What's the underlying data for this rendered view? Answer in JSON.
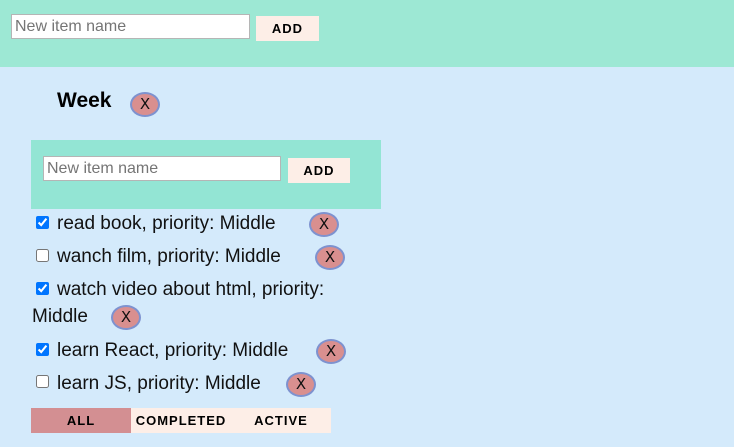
{
  "top": {
    "input_placeholder": "New item name",
    "add_label": "ADD"
  },
  "list": {
    "title": "Week",
    "delete_label": "X",
    "input_placeholder": "New item name",
    "add_label": "ADD",
    "tasks": [
      {
        "text": "read book, priority: Middle",
        "checked": true,
        "delete_label": "X"
      },
      {
        "text": "wanch film, priority: Middle",
        "checked": false,
        "delete_label": "X"
      },
      {
        "text_line1": "watch video about html, priority:",
        "text_line2": "Middle",
        "checked": true,
        "delete_label": "X"
      },
      {
        "text": "learn React, priority: Middle",
        "checked": true,
        "delete_label": "X"
      },
      {
        "text": "learn JS, priority: Middle",
        "checked": false,
        "delete_label": "X"
      }
    ],
    "filters": [
      {
        "label": "ALL",
        "active": true
      },
      {
        "label": "COMPLETED",
        "active": false
      },
      {
        "label": "ACTIVE",
        "active": false
      }
    ]
  },
  "colors": {
    "page_bg": "#d4eafb",
    "top_bar_bg": "#9de8d4",
    "list_input_bg": "#93e5d4",
    "button_bg": "#fdeee7",
    "active_filter_bg": "#d38f92",
    "delete_bg": "#d98f8f",
    "delete_border": "#7e92cf"
  }
}
